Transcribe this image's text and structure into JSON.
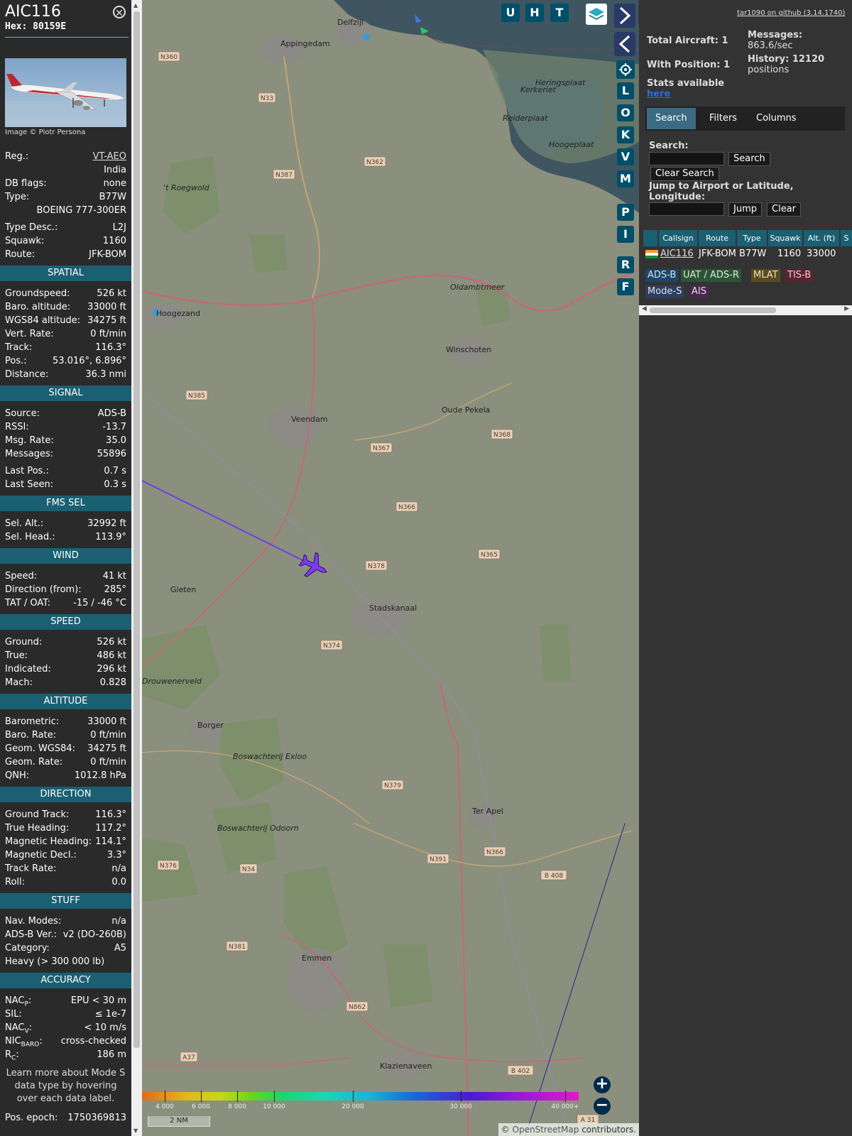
{
  "info": {
    "callsign": "AIC116",
    "hex": "Hex: 80159E",
    "photo_credit": "Image © Piotr Persona",
    "basic": [
      {
        "k": "Reg.:",
        "v": "VT-AEO",
        "link": true
      },
      {
        "k": "",
        "v": "India"
      },
      {
        "k": "DB flags:",
        "v": "none"
      },
      {
        "k": "Type:",
        "v": "B77W"
      },
      {
        "k": "",
        "v": "BOEING 777-300ER"
      },
      {
        "k": "Type Desc.:",
        "v": "L2J"
      },
      {
        "k": "Squawk:",
        "v": "1160"
      },
      {
        "k": "Route:",
        "v": "JFK-BOM"
      }
    ],
    "sections": [
      {
        "title": "SPATIAL",
        "rows": [
          {
            "k": "Groundspeed:",
            "v": "526 kt"
          },
          {
            "k": "Baro. altitude:",
            "v": "33000 ft"
          },
          {
            "k": "WGS84 altitude:",
            "v": "34275 ft"
          },
          {
            "k": "Vert. Rate:",
            "v": "0 ft/min"
          },
          {
            "k": "Track:",
            "v": "116.3°"
          },
          {
            "k": "Pos.:",
            "v": "53.016°, 6.896°"
          },
          {
            "k": "Distance:",
            "v": "36.3 nmi"
          }
        ]
      },
      {
        "title": "SIGNAL",
        "rows": [
          {
            "k": "Source:",
            "v": "ADS-B"
          },
          {
            "k": "RSSI:",
            "v": "-13.7"
          },
          {
            "k": "Msg. Rate:",
            "v": "35.0"
          },
          {
            "k": "Messages:",
            "v": "55896"
          },
          {
            "k": "Last Pos.:",
            "v": "0.7 s"
          },
          {
            "k": "Last Seen:",
            "v": "0.3 s"
          }
        ]
      },
      {
        "title": "FMS SEL",
        "rows": [
          {
            "k": "Sel. Alt.:",
            "v": "32992 ft"
          },
          {
            "k": "Sel. Head.:",
            "v": "113.9°"
          }
        ]
      },
      {
        "title": "WIND",
        "rows": [
          {
            "k": "Speed:",
            "v": "41 kt"
          },
          {
            "k": "Direction (from):",
            "v": "285°"
          },
          {
            "k": "TAT / OAT:",
            "v": "-15 / -46 °C"
          }
        ]
      },
      {
        "title": "SPEED",
        "rows": [
          {
            "k": "Ground:",
            "v": "526 kt"
          },
          {
            "k": "True:",
            "v": "486 kt"
          },
          {
            "k": "Indicated:",
            "v": "296 kt"
          },
          {
            "k": "Mach:",
            "v": "0.828"
          }
        ]
      },
      {
        "title": "ALTITUDE",
        "rows": [
          {
            "k": "Barometric:",
            "v": "33000 ft"
          },
          {
            "k": "Baro. Rate:",
            "v": "0 ft/min"
          },
          {
            "k": "Geom. WGS84:",
            "v": "34275 ft"
          },
          {
            "k": "Geom. Rate:",
            "v": "0 ft/min"
          },
          {
            "k": "QNH:",
            "v": "1012.8 hPa"
          }
        ]
      },
      {
        "title": "DIRECTION",
        "rows": [
          {
            "k": "Ground Track:",
            "v": "116.3°"
          },
          {
            "k": "True Heading:",
            "v": "117.2°"
          },
          {
            "k": "Magnetic Heading:",
            "v": "114.1°"
          },
          {
            "k": "Magnetic Decl.:",
            "v": "3.3°"
          },
          {
            "k": "Track Rate:",
            "v": "n/a"
          },
          {
            "k": "Roll:",
            "v": "0.0"
          }
        ]
      },
      {
        "title": "STUFF",
        "rows": [
          {
            "k": "Nav. Modes:",
            "v": "n/a"
          },
          {
            "k": "ADS-B Ver.:",
            "v": "v2 (DO-260B)"
          },
          {
            "k": "Category:",
            "v": "A5"
          },
          {
            "k": "Heavy (> 300 000 lb)",
            "v": ""
          }
        ]
      },
      {
        "title": "ACCURACY",
        "rows": [
          {
            "k": "NAC",
            "sub": "P",
            "v": "EPU < 30 m"
          },
          {
            "k": "SIL:",
            "v": "≤ 1e-7"
          },
          {
            "k": "NAC",
            "sub": "V",
            "v": "< 10 m/s"
          },
          {
            "k": "NIC",
            "sub": "BARO",
            "v": "cross-checked"
          },
          {
            "k": "R",
            "sub": "C",
            "v": "186 m"
          }
        ]
      }
    ],
    "note": "Learn more about Mode S data type by hovering over each data label.",
    "epoch_label": "Pos. epoch:",
    "epoch_value": "1750369813"
  },
  "map": {
    "top_buttons": [
      "U",
      "H",
      "T"
    ],
    "side_buttons": [
      "L",
      "O",
      "K",
      "V",
      "M",
      "P",
      "I",
      "R",
      "F"
    ],
    "towns": [
      {
        "name": "Delfzijl"
      },
      {
        "name": "Appingedam"
      },
      {
        "name": "Hoogezand"
      },
      {
        "name": "Winschoten"
      },
      {
        "name": "Veendam"
      },
      {
        "name": "Oude Pekela"
      },
      {
        "name": "Gieten"
      },
      {
        "name": "Stadskanaal"
      },
      {
        "name": "Borger"
      },
      {
        "name": "Ter Apel"
      },
      {
        "name": "Emmen"
      },
      {
        "name": "Klazienaveen"
      },
      {
        "name": "Drouwenerveld"
      },
      {
        "name": "Boswachterij Exloo"
      },
      {
        "name": "Boswachterij Odoorn"
      },
      {
        "name": "Kerkeriet"
      },
      {
        "name": "Heringsplaat"
      },
      {
        "name": "Reiderplaat"
      },
      {
        "name": "Hoogeplaat"
      },
      {
        "name": "Oldambtmeer"
      },
      {
        "name": "'t Roegwold"
      }
    ],
    "road_labels": [
      "N360",
      "N33",
      "N387",
      "N362",
      "N385",
      "N367",
      "N368",
      "N366",
      "N365",
      "N378",
      "N374",
      "N379",
      "N391",
      "N366",
      "N376",
      "N34",
      "N381",
      "N862",
      "A37",
      "B 402",
      "B 408",
      "A 31"
    ],
    "altitude_scale": [
      "4 000",
      "6 000",
      "8 000",
      "10 000",
      "20 000",
      "30 000",
      "40 000+"
    ],
    "scale_label": "2 NM",
    "attribution_prefix": "© ",
    "attribution_link": "OpenStreetMap",
    "attribution_suffix": " contributors."
  },
  "side": {
    "version_link": "tar1090 on github (3.14.1740)",
    "total_aircraft": "Total Aircraft: 1",
    "with_position": "With Position: 1",
    "messages_label": "Messages:",
    "messages_value": "863.6/sec",
    "history_label": "History: 12120",
    "history_value": "positions",
    "stats_label": "Stats available",
    "stats_link": "here",
    "tabs": [
      "Search",
      "Filters",
      "Columns"
    ],
    "search_label": "Search:",
    "search_button": "Search",
    "clear_search_button": "Clear Search",
    "jump_label": "Jump to Airport or Latitude, Longitude:",
    "jump_button": "Jump",
    "clear_button": "Clear",
    "table_headers": [
      "Callsign",
      "Route",
      "Type",
      "Squawk",
      "Alt. (ft)",
      "S"
    ],
    "row": {
      "callsign": "AIC116",
      "route": "JFK-BOM",
      "type": "B77W",
      "squawk": "1160",
      "alt": "33000"
    },
    "sources": [
      {
        "label": "ADS-B",
        "bg": "#1f4663",
        "fg": "#cfe3f5"
      },
      {
        "label": "UAT / ADS-R",
        "bg": "#2d5438",
        "fg": "#d7ecd4"
      },
      {
        "label": "MLAT",
        "bg": "#5a4b22",
        "fg": "#efe2b7"
      },
      {
        "label": "TIS-B",
        "bg": "#5a2432",
        "fg": "#f2c9d1"
      },
      {
        "label": "Mode-S",
        "bg": "#2f3e5e",
        "fg": "#d8e1f4"
      },
      {
        "label": "AIS",
        "bg": "#47294d",
        "fg": "#eed5f2"
      }
    ]
  }
}
